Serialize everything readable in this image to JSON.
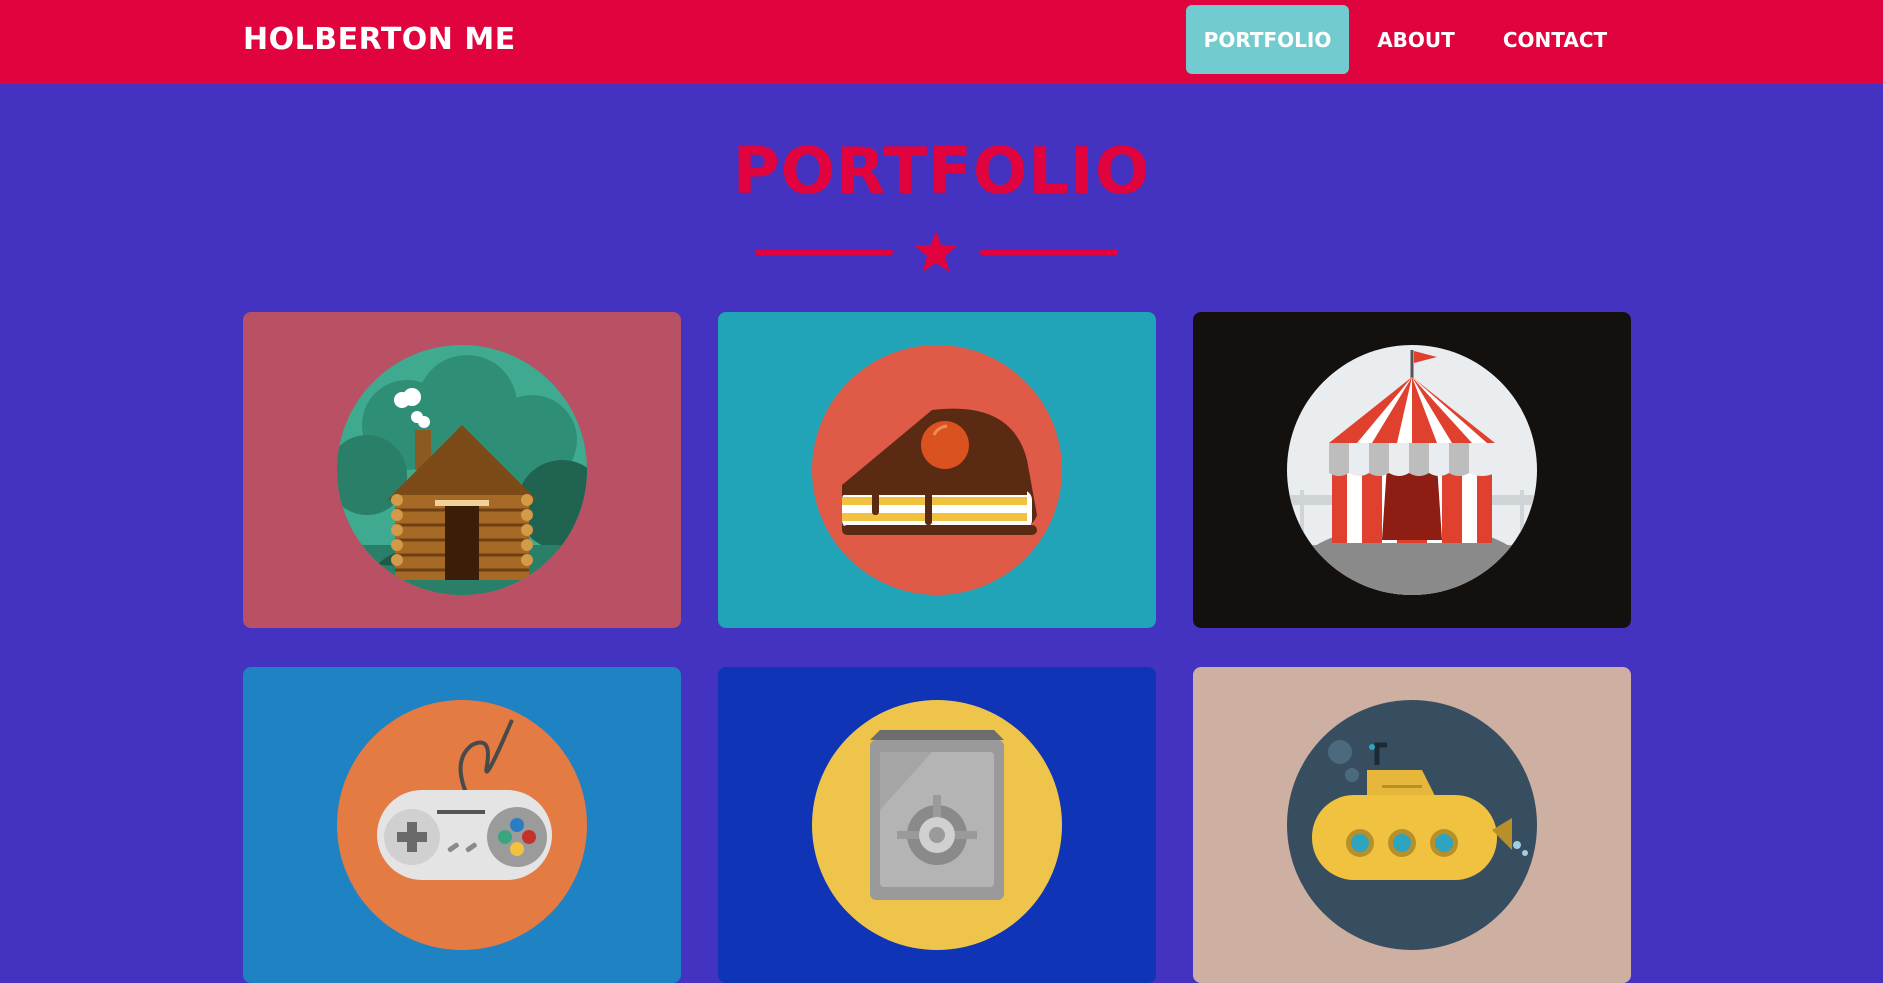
{
  "brand": "HOLBERTON ME",
  "nav": {
    "items": [
      {
        "label": "PORTFOLIO",
        "active": true
      },
      {
        "label": "ABOUT",
        "active": false
      },
      {
        "label": "CONTACT",
        "active": false
      }
    ]
  },
  "section": {
    "title": "PORTFOLIO",
    "divider_icon": "star-icon"
  },
  "colors": {
    "navbar": "#e0033d",
    "background": "#4433c1",
    "accent": "#e0033d",
    "active_nav": "#72cbcf"
  },
  "portfolio_items": [
    {
      "icon": "log-cabin-icon",
      "card_color": "#ba5064",
      "circle_color": "#3faa8f"
    },
    {
      "icon": "cake-slice-icon",
      "card_color": "#21a4b7",
      "circle_color": "#e05a48"
    },
    {
      "icon": "circus-tent-icon",
      "card_color": "#14100e",
      "circle_color": "#e9edef"
    },
    {
      "icon": "game-controller-icon",
      "card_color": "#1f82c3",
      "circle_color": "#e47b42"
    },
    {
      "icon": "safe-icon",
      "card_color": "#0f34b6",
      "circle_color": "#eec44a"
    },
    {
      "icon": "submarine-icon",
      "card_color": "#cdb0a2",
      "circle_color": "#364e60"
    }
  ]
}
